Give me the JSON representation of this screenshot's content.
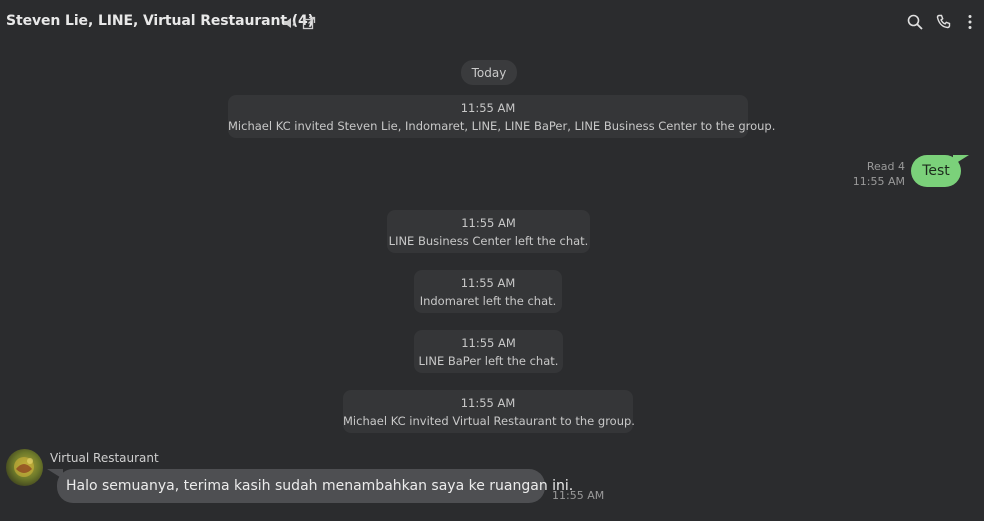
{
  "header": {
    "title": "Steven Lie, LINE, Virtual Restaurant (4)",
    "icons": [
      "speaker-icon",
      "popout-icon",
      "search-icon",
      "phone-icon",
      "more-icon"
    ]
  },
  "date_label": "Today",
  "system_messages": [
    {
      "time": "11:55 AM",
      "text": "Michael KC invited Steven Lie, Indomaret, LINE, LINE BaPer, LINE Business Center to the group."
    },
    {
      "time": "11:55 AM",
      "text": "LINE Business Center left the chat."
    },
    {
      "time": "11:55 AM",
      "text": "Indomaret left the chat."
    },
    {
      "time": "11:55 AM",
      "text": "LINE BaPer left the chat."
    },
    {
      "time": "11:55 AM",
      "text": "Michael KC invited Virtual Restaurant to the group."
    }
  ],
  "outgoing": {
    "read": "Read 4",
    "time": "11:55 AM",
    "text": "Test",
    "bubble_color": "#7bd17a"
  },
  "incoming": {
    "sender": "Virtual Restaurant",
    "text": "Halo semuanya, terima kasih sudah menambahkan saya ke ruangan ini.",
    "time": "11:55 AM",
    "bubble_color": "#4e4f52"
  },
  "colors": {
    "background": "#2b2c2e",
    "system_bubble": "#353638"
  }
}
